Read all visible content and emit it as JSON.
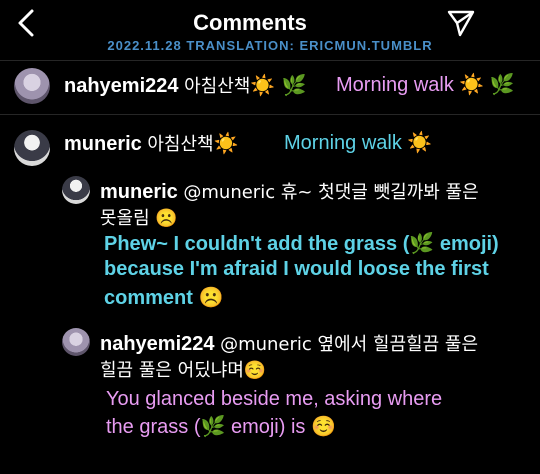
{
  "header": {
    "title": "Comments",
    "credit": "2022.11.28  TRANSLATION: ERICMUN.TUMBLR"
  },
  "comments": [
    {
      "username": "nahyemi224",
      "text": "아침산책",
      "emojis": "☀️ 🌿",
      "translation": "Morning walk ☀️ 🌿"
    },
    {
      "username": "muneric",
      "text": "아침산책",
      "emojis": "☀️",
      "translation": "Morning walk ☀️"
    }
  ],
  "replies": [
    {
      "username": "muneric",
      "text_line1": "@muneric 휴~ 첫댓글 뺏길까봐 풀은",
      "text_line2": "못올림 ☹️",
      "translation_line1": "Phew~ I couldn't add the grass (🌿 emoji)",
      "translation_line2": "because I'm afraid I would loose the first",
      "translation_line3": "comment ☹️"
    },
    {
      "username": "nahyemi224",
      "text_line1": "@muneric 옆에서 힐끔힐끔 풀은",
      "text_line2": "힐끔 풀은 어딨냐며☺️",
      "translation_line1": "You glanced beside me, asking where",
      "translation_line2": "the grass (🌿 emoji) is ☺️"
    }
  ],
  "icons": {
    "back": "back-chevron-icon",
    "send": "send-paper-plane-icon"
  },
  "colors": {
    "background": "#000000",
    "credit": "#4a8fc8",
    "pink_translation": "#e89cf2",
    "cyan_translation": "#5ed2e6"
  }
}
